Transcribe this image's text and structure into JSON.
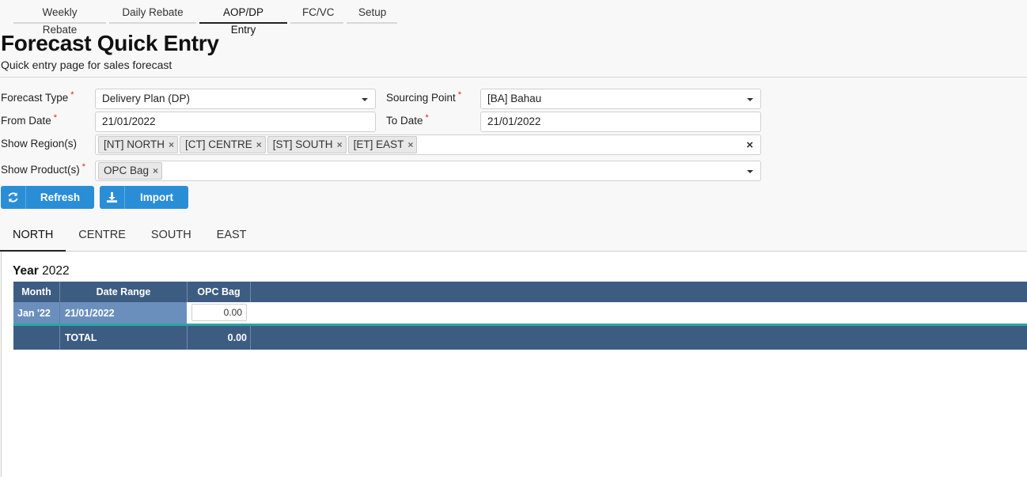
{
  "nav": {
    "tabs": [
      {
        "label": "Weekly Rebate"
      },
      {
        "label": "Daily Rebate"
      },
      {
        "label": "AOP/DP Entry"
      },
      {
        "label": "FC/VC"
      },
      {
        "label": "Setup"
      }
    ]
  },
  "header": {
    "title": "Forecast Quick Entry",
    "subtitle": "Quick entry page for sales forecast"
  },
  "form": {
    "forecast_type": {
      "label": "Forecast Type",
      "value": "Delivery Plan (DP)"
    },
    "sourcing_point": {
      "label": "Sourcing Point",
      "value": "[BA] Bahau"
    },
    "from_date": {
      "label": "From Date",
      "value": "21/01/2022"
    },
    "to_date": {
      "label": "To Date",
      "value": "21/01/2022"
    },
    "regions": {
      "label": "Show Region(s)",
      "chips": [
        "[NT] NORTH",
        "[CT] CENTRE",
        "[ST] SOUTH",
        "[ET] EAST"
      ]
    },
    "products": {
      "label": "Show Product(s)",
      "chips": [
        "OPC Bag"
      ]
    },
    "required_mark": "*",
    "chip_remove": "×",
    "clear_all": "×"
  },
  "actions": {
    "refresh_label": "Refresh",
    "import_label": "Import"
  },
  "region_tabs": [
    {
      "label": "NORTH"
    },
    {
      "label": "CENTRE"
    },
    {
      "label": "SOUTH"
    },
    {
      "label": "EAST"
    }
  ],
  "grid": {
    "year_label": "Year",
    "year_value": "2022",
    "columns": [
      "Month",
      "Date Range",
      "OPC Bag"
    ],
    "rows": [
      {
        "month": "Jan '22",
        "date_range": "21/01/2022",
        "opc_bag": "0.00"
      }
    ],
    "total_label": "TOTAL",
    "total_value": "0.00"
  },
  "colors": {
    "accent": "#2a8ed6",
    "grid_header": "#3d5c82",
    "row_highlight": "#6a8fbd",
    "separator": "#2aa6a6"
  }
}
